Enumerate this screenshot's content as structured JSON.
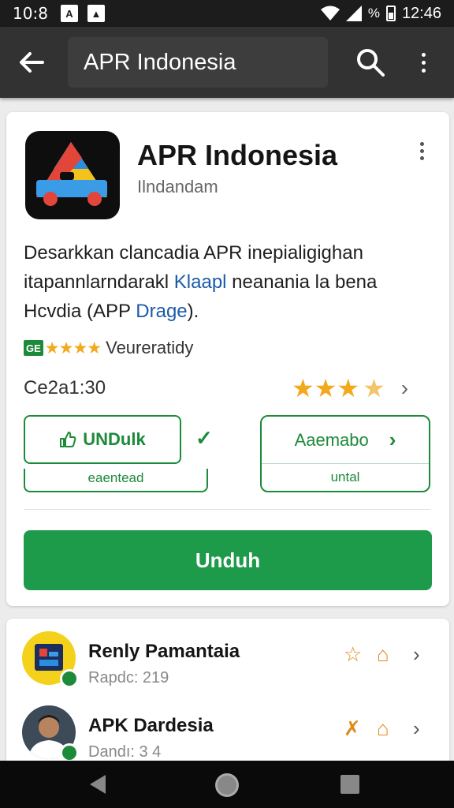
{
  "status_bar": {
    "time_left": "10:8",
    "battery_pct": "%",
    "time_right": "12:46"
  },
  "app_bar": {
    "search_text": "APR Indonesia"
  },
  "app": {
    "title": "APR Indonesia",
    "developer": "Ilndandam",
    "description_line1": "Desarkkan clancadia  APR inepialigighan",
    "description_line2a": "itapannlarndarakl ",
    "description_line2_link": "Klaapl",
    "description_line2b": " neanania  la bena",
    "description_line3a": "Hcvdia (APP ",
    "description_line3_link": "Drage",
    "description_line3b": ").",
    "badge": "GE",
    "small_stars": "★★★★",
    "rating_label": "Veureratidy",
    "meta": "Ce2a1:30",
    "big_stars": "★★★",
    "big_half_star": "★"
  },
  "buttons": {
    "unduh_outline": "UNDulk",
    "under_left": "eaentead",
    "right_top": "Aaemabo",
    "right_bottom": "untal",
    "primary": "Unduh"
  },
  "list": [
    {
      "name": "Renly  Pamantaia",
      "sub": "Rapdc: 219"
    },
    {
      "name": "APK Dardesia",
      "sub": "Dandı: 3 4"
    }
  ],
  "colors": {
    "accent_green": "#1e9a4b",
    "star_orange": "#f2a91c",
    "link_blue": "#1a5aa8",
    "app_bar": "#323232"
  }
}
